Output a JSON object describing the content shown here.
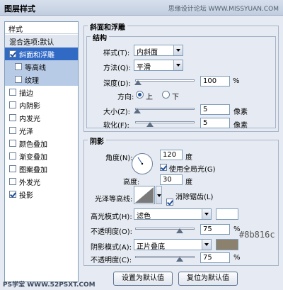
{
  "title": "图层样式",
  "watermark_top": "思缘设计论坛 WWW.MISSYUAN.COM",
  "watermark_bottom": "PS学堂 WWW.52PSXT.COM",
  "style_list": {
    "header": "样式",
    "blend_defaults": "混合选项:默认",
    "items": [
      {
        "label": "斜面和浮雕",
        "checked": true,
        "state": "selected",
        "sub": false
      },
      {
        "label": "等高线",
        "checked": false,
        "state": "subsel",
        "sub": true
      },
      {
        "label": "纹理",
        "checked": false,
        "state": "subsel",
        "sub": true
      },
      {
        "label": "描边",
        "checked": false,
        "state": "",
        "sub": false
      },
      {
        "label": "内阴影",
        "checked": false,
        "state": "",
        "sub": false
      },
      {
        "label": "内发光",
        "checked": false,
        "state": "",
        "sub": false
      },
      {
        "label": "光泽",
        "checked": false,
        "state": "",
        "sub": false
      },
      {
        "label": "颜色叠加",
        "checked": false,
        "state": "",
        "sub": false
      },
      {
        "label": "渐变叠加",
        "checked": false,
        "state": "",
        "sub": false
      },
      {
        "label": "图案叠加",
        "checked": false,
        "state": "",
        "sub": false
      },
      {
        "label": "外发光",
        "checked": false,
        "state": "",
        "sub": false
      },
      {
        "label": "投影",
        "checked": true,
        "state": "",
        "sub": false
      }
    ]
  },
  "bevel": {
    "group_title": "斜面和浮雕",
    "structure_title": "结构",
    "style_label": "样式(T):",
    "style_value": "内斜面",
    "technique_label": "方法(Q):",
    "technique_value": "平滑",
    "depth_label": "深度(D):",
    "depth_value": "100",
    "depth_level": 0.05,
    "percent": "%",
    "direction_label": "方向:",
    "dir_up": "上",
    "dir_down": "下",
    "size_label": "大小(Z):",
    "size_value": "5",
    "size_level": 0.03,
    "soften_label": "软化(F):",
    "soften_value": "5",
    "soften_level": 0.25,
    "px": "像素"
  },
  "shading": {
    "title": "阴影",
    "angle_label": "角度(N):",
    "angle_value": "120",
    "deg": "度",
    "global_light_label": "使用全局光(G)",
    "global_light": true,
    "altitude_label": "高度:",
    "altitude_value": "30",
    "gloss_label": "光泽等高线:",
    "antialias_label": "消除锯齿(L)",
    "antialias": true,
    "highlight_label": "高光模式(H):",
    "highlight_value": "滤色",
    "highlight_opacity_label": "不透明度(O):",
    "highlight_opacity": "75",
    "highlight_opacity_level": 0.75,
    "shadow_label": "阴影模式(A):",
    "shadow_value": "正片叠底",
    "shadow_opacity_label": "不透明度(C):",
    "shadow_opacity": "75",
    "shadow_opacity_level": 0.75,
    "highlight_color": "#ffffff",
    "shadow_color": "#8b816c",
    "shadow_color_note": "#8b816c"
  },
  "buttons": {
    "make_default": "设置为默认值",
    "reset_default": "复位为默认值"
  }
}
